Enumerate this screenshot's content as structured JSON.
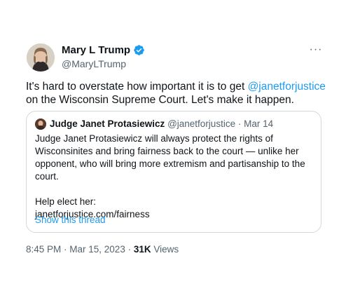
{
  "author": {
    "name": "Mary L Trump",
    "handle": "@MaryLTrump",
    "verified_color": "#1d9bf0"
  },
  "tweet": {
    "text_before": "It's hard to overstate how important it is to get ",
    "mention": "@janetforjustice",
    "text_after": " on the Wisconsin Supreme Court. Let's make it happen.",
    "posted": "8:45 PM · Mar 15, 2023 · ",
    "views_count": "31K",
    "views_label": " Views"
  },
  "quote": {
    "name": "Judge Janet Protasiewicz",
    "handle": "@janetforjustice",
    "separator": " · ",
    "date": "Mar 14",
    "lines": [
      "Judge Janet Protasiewicz will always protect the rights of",
      "Wisconsinites and bring fairness back to the court — unlike her",
      "opponent, who will bring more extremism and partisanship to the",
      "court."
    ],
    "help_line": "Help elect her:",
    "link_line": "janetforjustice.com/fairness",
    "show_thread": "Show this thread"
  },
  "icons": {
    "more": "more-options-icon",
    "verified": "verified-badge-icon"
  },
  "colors": {
    "accent": "#1d9bf0",
    "secondary_text": "#536471",
    "border": "#cfd9de"
  }
}
